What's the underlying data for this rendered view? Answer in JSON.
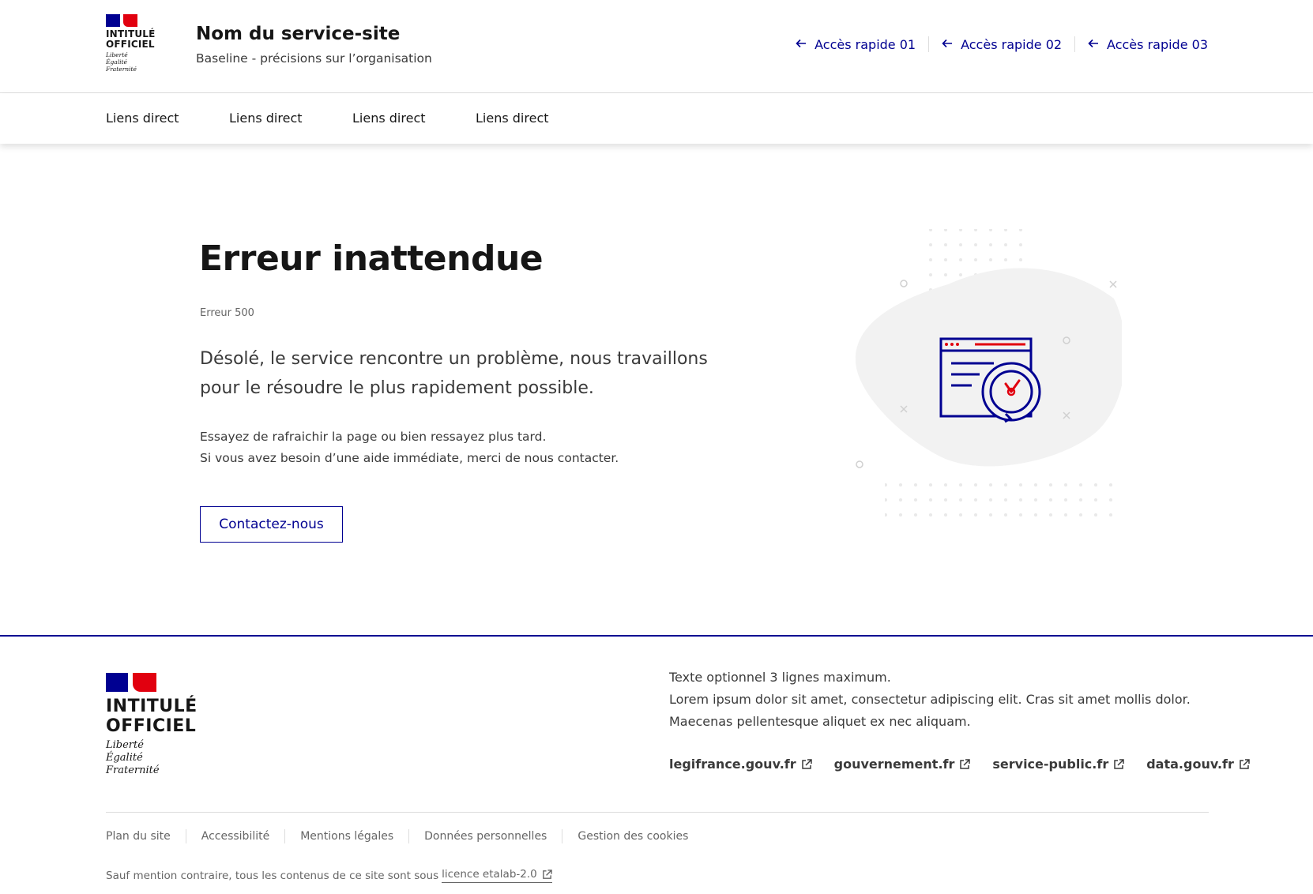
{
  "header": {
    "logo": {
      "line1": "INTITULÉ",
      "line2": "OFFICIEL",
      "motto1": "Liberté",
      "motto2": "Égalité",
      "motto3": "Fraternité"
    },
    "service_title": "Nom du service-site",
    "baseline": "Baseline - précisions sur l’organisation",
    "quick_links": [
      {
        "label": "Accès rapide 01",
        "icon": "arrow-left-icon"
      },
      {
        "label": "Accès rapide 02",
        "icon": "arrow-left-icon"
      },
      {
        "label": "Accès rapide 03",
        "icon": "arrow-left-icon"
      }
    ]
  },
  "nav": {
    "items": [
      {
        "label": "Liens direct"
      },
      {
        "label": "Liens direct"
      },
      {
        "label": "Liens direct"
      },
      {
        "label": "Liens direct"
      }
    ]
  },
  "main": {
    "title": "Erreur inattendue",
    "code": "Erreur 500",
    "lead_line1": "Désolé, le service rencontre un problème, nous travaillons",
    "lead_line2": "pour le résoudre le plus rapidement possible.",
    "text_line1": "Essayez de rafraichir la page ou bien ressayez plus tard.",
    "text_line2": "Si vous avez besoin d’une aide immédiate, merci de nous contacter.",
    "contact_button": "Contactez-nous",
    "illustration_icon": "browser-timer-error-icon"
  },
  "footer": {
    "logo": {
      "line1": "INTITULÉ",
      "line2": "OFFICIEL",
      "motto1": "Liberté",
      "motto2": "Égalité",
      "motto3": "Fraternité"
    },
    "desc_line1": "Texte optionnel 3 lignes maximum.",
    "desc_line2": "Lorem ipsum dolor sit amet, consectetur adipiscing elit. Cras sit amet mollis dolor.",
    "desc_line3": "Maecenas pellentesque aliquet ex nec aliquam.",
    "links": [
      {
        "label": "legifrance.gouv.fr"
      },
      {
        "label": "gouvernement.fr"
      },
      {
        "label": "service-public.fr"
      },
      {
        "label": "data.gouv.fr"
      }
    ],
    "bottom_links": [
      {
        "label": "Plan du site"
      },
      {
        "label": "Accessibilité"
      },
      {
        "label": "Mentions légales"
      },
      {
        "label": "Données personnelles"
      },
      {
        "label": "Gestion des cookies"
      }
    ],
    "license_text": "Sauf mention contraire, tous les contenus de ce site sont sous",
    "license_link": "licence etalab-2.0"
  },
  "colors": {
    "primary": "#000091",
    "accent_red": "#e1000f",
    "text": "#161616",
    "muted": "#666666"
  }
}
